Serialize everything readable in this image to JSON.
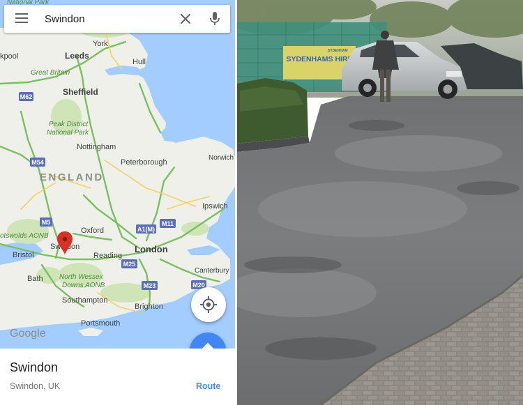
{
  "search": {
    "value": "Swindon",
    "placeholder": ""
  },
  "map": {
    "places": {
      "york": "York",
      "leeds": "Leeds",
      "hull": "Hull",
      "bradford": "kpool",
      "great_britain": "Great Britain",
      "sheffield": "Sheffield",
      "peak_district": "Peak District",
      "national_park": "National Park",
      "nottingham": "Nottingham",
      "norwich": "Norwich",
      "peterborough": "Peterborough",
      "england": "ENGLAND",
      "ipswich": "Ipswich",
      "oxford": "Oxford",
      "cotswolds": "otswolds AONB",
      "swindon": "Swindon",
      "london": "London",
      "bristol": "Bristol",
      "reading": "Reading",
      "canterbury": "Canterbury",
      "bath": "Bath",
      "north_wessex": "North Wessex",
      "downs_aonb": "Downs AONB",
      "southampton": "Southampton",
      "brighton": "Brighton",
      "portsmouth": "Portsmouth",
      "national_park_top": "National Park",
      "google": "Google"
    },
    "roads": {
      "m62": "M62",
      "m54": "M54",
      "m5": "M5",
      "a1m": "A1(M)",
      "m11": "M11",
      "m25": "M25",
      "m23": "M23",
      "m20": "M20"
    }
  },
  "place_card": {
    "title": "Swindon",
    "subtitle": "Swindon, UK",
    "route_label": "Route"
  },
  "photo": {
    "hoarding_text": "SYDENHAMS HIRE",
    "hoarding_small": "SYDENHAM"
  },
  "icons": {
    "menu": "menu-icon",
    "clear": "close-icon",
    "mic": "mic-icon",
    "location": "my-location-icon",
    "directions": "directions-icon",
    "pin": "map-pin-icon"
  },
  "colors": {
    "water": "#a3ccff",
    "land": "#eef0e9",
    "motorway": "#79c05e",
    "road_shield": "#5b6fb8",
    "accent_blue": "#4285f4",
    "pin_red": "#d93025"
  }
}
